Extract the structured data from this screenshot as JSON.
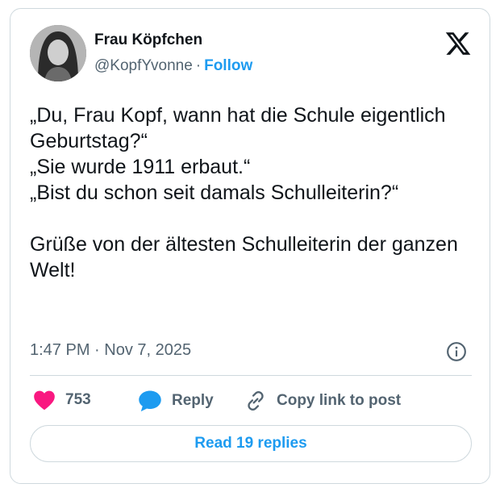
{
  "author": {
    "name": "Frau Köpfchen",
    "handle": "@KopfYvonne",
    "separator": "·",
    "follow_label": "Follow"
  },
  "tweet": {
    "lines": [
      "„Du, Frau Kopf, wann hat die Schule eigentlich Geburtstag?“",
      "„Sie wurde 1911 erbaut.“",
      "„Bist du schon seit damals Schulleiterin?“",
      "Grüße von der ältesten Schulleiterin der ganzen Welt!"
    ],
    "timestamp": "1:47 PM · Nov 7, 2025"
  },
  "actions": {
    "like_count": "753",
    "reply_label": "Reply",
    "copy_label": "Copy link to post"
  },
  "read_replies_label": "Read 19 replies",
  "colors": {
    "accent": "#1d9bf0",
    "heart": "#f91880",
    "secondary_text": "#536471",
    "border": "#cfd9de"
  },
  "icons": [
    "x-logo-icon",
    "info-icon",
    "heart-icon",
    "reply-bubble-icon",
    "link-icon"
  ]
}
